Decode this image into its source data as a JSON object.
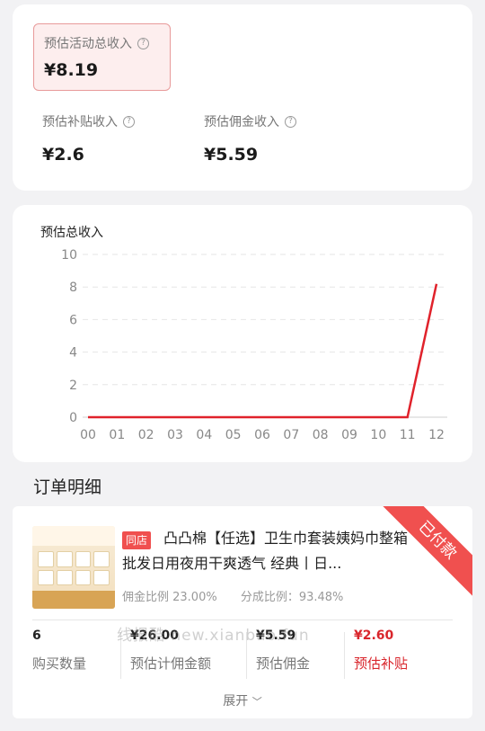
{
  "summary": {
    "total_label": "预估活动总收入",
    "total_value": "¥8.19",
    "subsidy_label": "预估补贴收入",
    "subsidy_value": "¥2.6",
    "commission_label": "预估佣金收入",
    "commission_value": "¥5.59",
    "help_icon": "question-circle-icon"
  },
  "chart_data": {
    "type": "line",
    "title": "预估总收入",
    "categories": [
      "00",
      "01",
      "02",
      "03",
      "04",
      "05",
      "06",
      "07",
      "08",
      "09",
      "10",
      "11",
      "12"
    ],
    "values": [
      0,
      0,
      0,
      0,
      0,
      0,
      0,
      0,
      0,
      0,
      0,
      0,
      8.19
    ],
    "yticks": [
      0,
      2,
      4,
      6,
      8,
      10
    ],
    "ylim": [
      0,
      10
    ],
    "grid": true,
    "color": "#e0222b"
  },
  "orders": {
    "title": "订单明细",
    "status_ribbon": "已付款",
    "store_tag": "同店",
    "product_title": "凸凸棉【任选】卫生巾套装姨妈巾整箱批发日用夜用干爽透气 经典丨日...",
    "commission_rate": "佣金比例 23.00%",
    "share_rate": "分成比例：93.48%",
    "metrics": [
      {
        "value": "6",
        "label": "购买数量"
      },
      {
        "value": "¥26.00",
        "label": "预估计佣金额"
      },
      {
        "value": "¥5.59",
        "label": "预估佣金"
      },
      {
        "value": "¥2.60",
        "label": "预估补贴"
      }
    ],
    "expand_label": "展开",
    "watermark": "线报酷 new.xianbao.fun"
  }
}
